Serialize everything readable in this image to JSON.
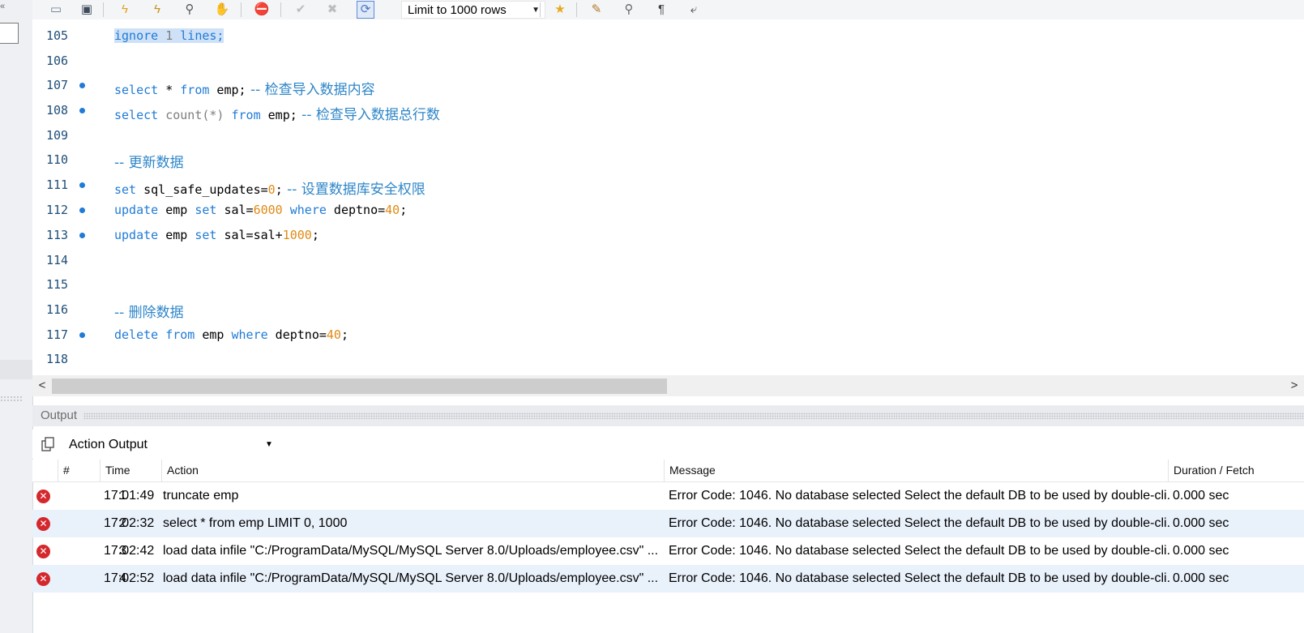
{
  "toolbar": {
    "limit_rows": "Limit to 1000 rows",
    "icons": [
      "folder-open-icon",
      "save-icon",
      "execute-icon",
      "execute-current-icon",
      "explain-icon",
      "stop-icon",
      "toggle-error-icon",
      "commit-icon",
      "rollback-icon",
      "autocommit-icon",
      "add-snippet-icon",
      "beautify-icon",
      "find-icon",
      "invisible-chars-icon",
      "wrap-icon"
    ]
  },
  "editor": {
    "lines": [
      {
        "no": "105",
        "bp": false
      },
      {
        "no": "106",
        "bp": false
      },
      {
        "no": "107",
        "bp": true
      },
      {
        "no": "108",
        "bp": true
      },
      {
        "no": "109",
        "bp": false
      },
      {
        "no": "110",
        "bp": false
      },
      {
        "no": "111",
        "bp": true
      },
      {
        "no": "112",
        "bp": true
      },
      {
        "no": "113",
        "bp": true
      },
      {
        "no": "114",
        "bp": false
      },
      {
        "no": "115",
        "bp": false
      },
      {
        "no": "116",
        "bp": false
      },
      {
        "no": "117",
        "bp": true
      },
      {
        "no": "118",
        "bp": false
      }
    ],
    "t": {
      "ignore": "ignore",
      "one": "1",
      "lines": "lines;",
      "select": "select",
      "star_from_emp": " * ",
      "from": "from",
      "emp_semi": " emp;",
      "c107": " -- 检查导入数据内容",
      "count": "count(*)",
      "c108": " -- 检查导入数据总行数",
      "c110": "-- 更新数据",
      "set": "set",
      "sql_safe": " sql_safe_updates=",
      "zero": "0",
      "semi": ";",
      "c111": " -- 设置数据库安全权限",
      "update": "update",
      "emp": " emp ",
      "sal_eq": " sal=",
      "n6000": "6000",
      "where": "where",
      "deptno_eq": " deptno=",
      "n40": "40",
      "sal_plus": " sal=sal+",
      "n1000": "1000",
      "c116": "-- 删除数据",
      "delete": "delete"
    }
  },
  "output": {
    "panel_label": "Output",
    "selector": "Action Output",
    "columns": {
      "num": "#",
      "time": "Time",
      "action": "Action",
      "message": "Message",
      "duration": "Duration / Fetch"
    },
    "rows": [
      {
        "num": "1",
        "time": "17:01:49",
        "action": "truncate emp",
        "message": "Error Code: 1046. No database selected Select the default DB to be used by double-cli...",
        "duration": "0.000 sec"
      },
      {
        "num": "2",
        "time": "17:02:32",
        "action": "select * from emp LIMIT 0, 1000",
        "message": "Error Code: 1046. No database selected Select the default DB to be used by double-cli...",
        "duration": "0.000 sec"
      },
      {
        "num": "3",
        "time": "17:02:42",
        "action": "load data infile \"C:/ProgramData/MySQL/MySQL Server 8.0/Uploads/employee.csv\" ...",
        "message": "Error Code: 1046. No database selected Select the default DB to be used by double-cli...",
        "duration": "0.000 sec"
      },
      {
        "num": "4",
        "time": "17:02:52",
        "action": "load data infile \"C:/ProgramData/MySQL/MySQL Server 8.0/Uploads/employee.csv\" ...",
        "message": "Error Code: 1046. No database selected Select the default DB to be used by double-cli...",
        "duration": "0.000 sec"
      }
    ],
    "error_color": "#d4282d"
  }
}
